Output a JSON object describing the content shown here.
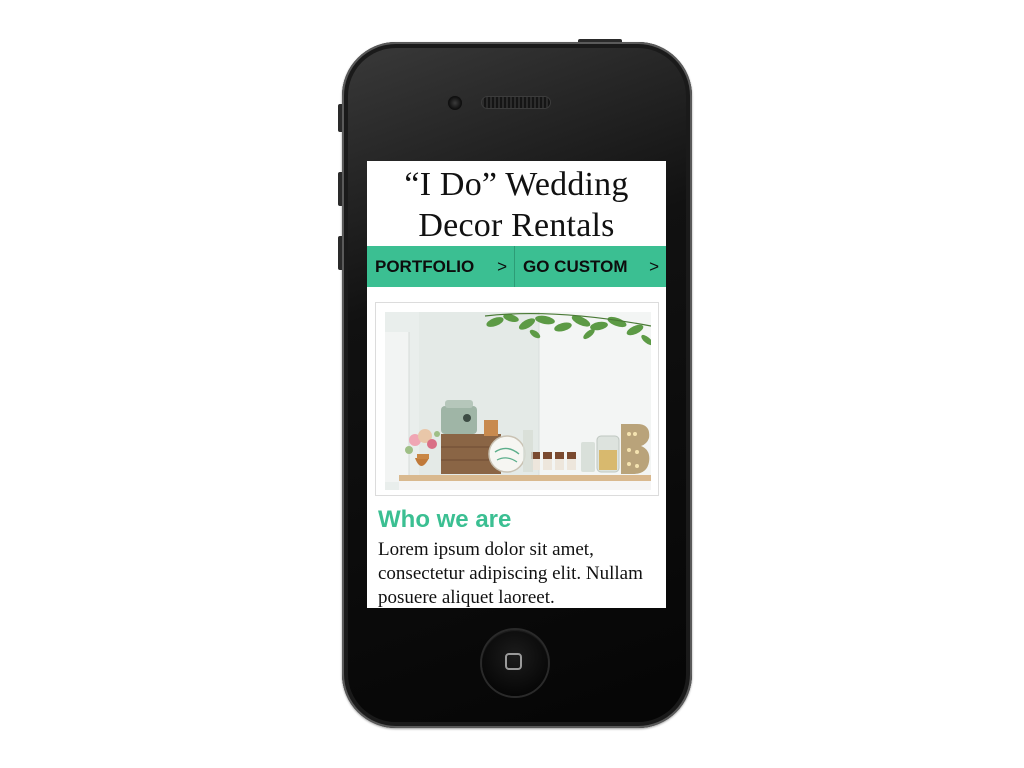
{
  "site": {
    "title_line1": "“I Do” Wedding",
    "title_line2": "Decor Rentals"
  },
  "nav": {
    "items": [
      {
        "label": "PORTFOLIO",
        "arrow": ">"
      },
      {
        "label": "GO CUSTOM",
        "arrow": ">"
      }
    ]
  },
  "about": {
    "heading": "Who we are",
    "body": "Lorem ipsum dolor sit amet, consectetur adipiscing elit. Nullam posuere aliquet laoreet."
  },
  "colors": {
    "accent": "#3bbf92",
    "phone_body": "#0a0a0a",
    "text": "#111111"
  },
  "icons": [
    "camera-icon",
    "speaker-grille-icon",
    "home-button-icon",
    "chevron-right-icon"
  ]
}
